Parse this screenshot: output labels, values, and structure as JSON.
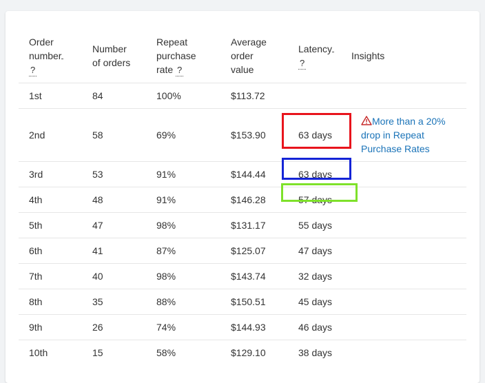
{
  "table": {
    "headers": {
      "order_number": [
        "Order",
        "number",
        "?"
      ],
      "number_of_orders": [
        "Number",
        "of orders"
      ],
      "repeat_rate": [
        "Repeat",
        "purchase",
        "rate",
        "?"
      ],
      "aov": [
        "Average",
        "order",
        "value"
      ],
      "latency": [
        "Latency",
        "?"
      ],
      "insights": "Insights"
    },
    "rows": [
      {
        "order": "1st",
        "orders": "84",
        "rate": "100%",
        "aov": "$113.72",
        "latency": ""
      },
      {
        "order": "2nd",
        "orders": "58",
        "rate": "69%",
        "aov": "$153.90",
        "latency": "63 days"
      },
      {
        "order": "3rd",
        "orders": "53",
        "rate": "91%",
        "aov": "$144.44",
        "latency": "63 days"
      },
      {
        "order": "4th",
        "orders": "48",
        "rate": "91%",
        "aov": "$146.28",
        "latency": "57 days"
      },
      {
        "order": "5th",
        "orders": "47",
        "rate": "98%",
        "aov": "$131.17",
        "latency": "55 days"
      },
      {
        "order": "6th",
        "orders": "41",
        "rate": "87%",
        "aov": "$125.07",
        "latency": "47 days"
      },
      {
        "order": "7th",
        "orders": "40",
        "rate": "98%",
        "aov": "$143.74",
        "latency": "32 days"
      },
      {
        "order": "8th",
        "orders": "35",
        "rate": "88%",
        "aov": "$150.51",
        "latency": "45 days"
      },
      {
        "order": "9th",
        "orders": "26",
        "rate": "74%",
        "aov": "$144.93",
        "latency": "46 days"
      },
      {
        "order": "10th",
        "orders": "15",
        "rate": "58%",
        "aov": "$129.10",
        "latency": "38 days"
      }
    ],
    "insight_row_2nd": {
      "icon": "warning-triangle-icon",
      "text": "More than a 20% drop in Repeat Purchase Rates"
    }
  },
  "highlights": {
    "row_2nd_color": "#e8141c",
    "row_3rd_color": "#1424d6",
    "row_4th_color": "#7ee12a"
  },
  "colors": {
    "link": "#1a73b8",
    "warning": "#c62828"
  }
}
